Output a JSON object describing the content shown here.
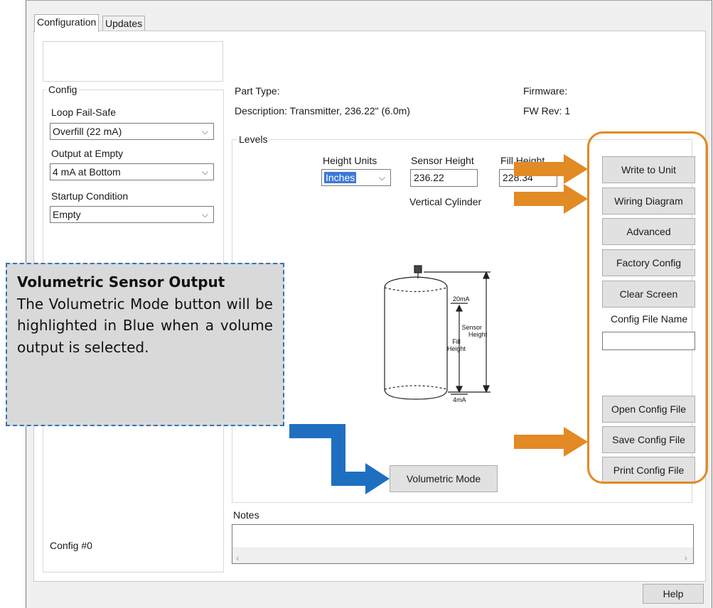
{
  "tabs": {
    "configuration": "Configuration",
    "updates": "Updates"
  },
  "config": {
    "legend": "Config",
    "loop_fail_safe": {
      "label": "Loop Fail-Safe",
      "value": "Overfill (22 mA)"
    },
    "output_at_empty": {
      "label": "Output at Empty",
      "value": "4 mA at Bottom"
    },
    "startup_condition": {
      "label": "Startup Condition",
      "value": "Empty"
    },
    "config_number": "Config #0"
  },
  "info": {
    "part_type": "Part Type:",
    "description": "Description: Transmitter, 236.22\" (6.0m)",
    "firmware": "Firmware:",
    "fw_rev": "FW Rev:  1"
  },
  "levels": {
    "legend": "Levels",
    "height_units": {
      "label": "Height Units",
      "value": "Inches"
    },
    "sensor_height": {
      "label": "Sensor Height",
      "value": "236.22"
    },
    "fill_height": {
      "label": "Fill Height",
      "value": "228.34"
    },
    "tank_shape": "Vertical Cylinder",
    "diagram": {
      "top_ma": "20mA",
      "bottom_ma": "4mA",
      "fill_l1": "Fill",
      "fill_l2": "Height",
      "sensor_l1": "Sensor",
      "sensor_l2": "Height"
    },
    "volumetric_mode": "Volumetric Mode"
  },
  "buttons": {
    "write_to_unit": "Write to Unit",
    "wiring_diagram": "Wiring Diagram",
    "advanced": "Advanced",
    "factory_config": "Factory Config",
    "clear_screen": "Clear Screen",
    "config_file_name_label": "Config File Name",
    "config_file_name_value": "",
    "open_config_file": "Open Config File",
    "save_config_file": "Save Config File",
    "print_config_file": "Print Config File",
    "help": "Help"
  },
  "notes": {
    "label": "Notes",
    "value": ""
  },
  "callout": {
    "title": "Volumetric Sensor Output",
    "body": "The Volumetric Mode button will be highlighted in Blue when a volume output is selected."
  },
  "colors": {
    "annotation_orange": "#e28a23",
    "annotation_blue": "#1f6fc1",
    "selection_blue": "#3c78d8"
  },
  "icons": [
    "chevron-down-icon",
    "scroll-left-icon",
    "scroll-right-icon",
    "arrow-right-icon"
  ]
}
